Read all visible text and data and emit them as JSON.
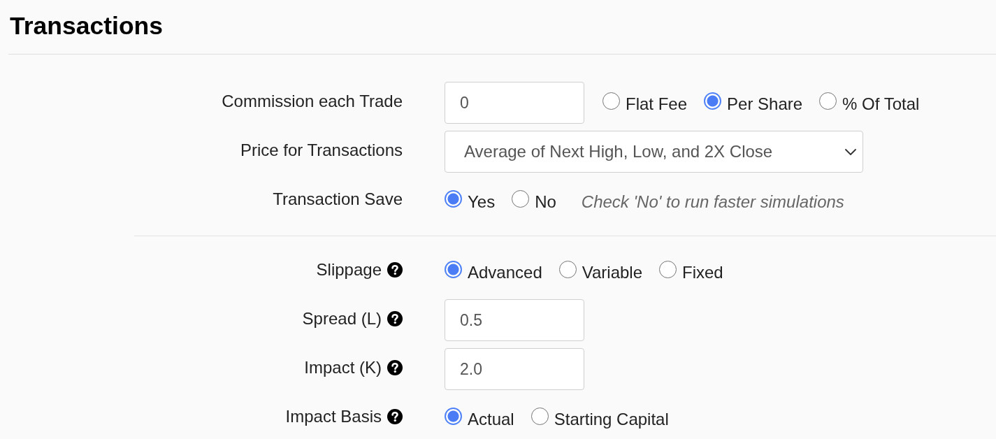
{
  "title": "Transactions",
  "sections": [
    {
      "rows": [
        {
          "kind": "input",
          "label": "Commission each Trade",
          "help": false,
          "value": "0",
          "options": [
            {
              "label": "Flat Fee",
              "selected": false
            },
            {
              "label": "Per Share",
              "selected": true
            },
            {
              "label": "% Of Total",
              "selected": false
            }
          ]
        },
        {
          "kind": "select",
          "label": "Price for Transactions",
          "help": false,
          "value": "Average of Next High, Low, and 2X Close"
        },
        {
          "kind": "radio",
          "label": "Transaction Save",
          "help": false,
          "options": [
            {
              "label": "Yes",
              "selected": true
            },
            {
              "label": "No",
              "selected": false
            }
          ],
          "note": "Check 'No' to run faster simulations"
        }
      ]
    },
    {
      "rows": [
        {
          "kind": "radio",
          "label": "Slippage",
          "help": true,
          "options": [
            {
              "label": "Advanced",
              "selected": true
            },
            {
              "label": "Variable",
              "selected": false
            },
            {
              "label": "Fixed",
              "selected": false
            }
          ]
        },
        {
          "kind": "input",
          "label": "Spread (L)",
          "help": true,
          "value": "0.5"
        },
        {
          "kind": "input",
          "label": "Impact (K)",
          "help": true,
          "value": "2.0"
        },
        {
          "kind": "radio",
          "label": "Impact Basis",
          "help": true,
          "options": [
            {
              "label": "Actual",
              "selected": true
            },
            {
              "label": "Starting Capital",
              "selected": false
            }
          ]
        }
      ]
    }
  ]
}
